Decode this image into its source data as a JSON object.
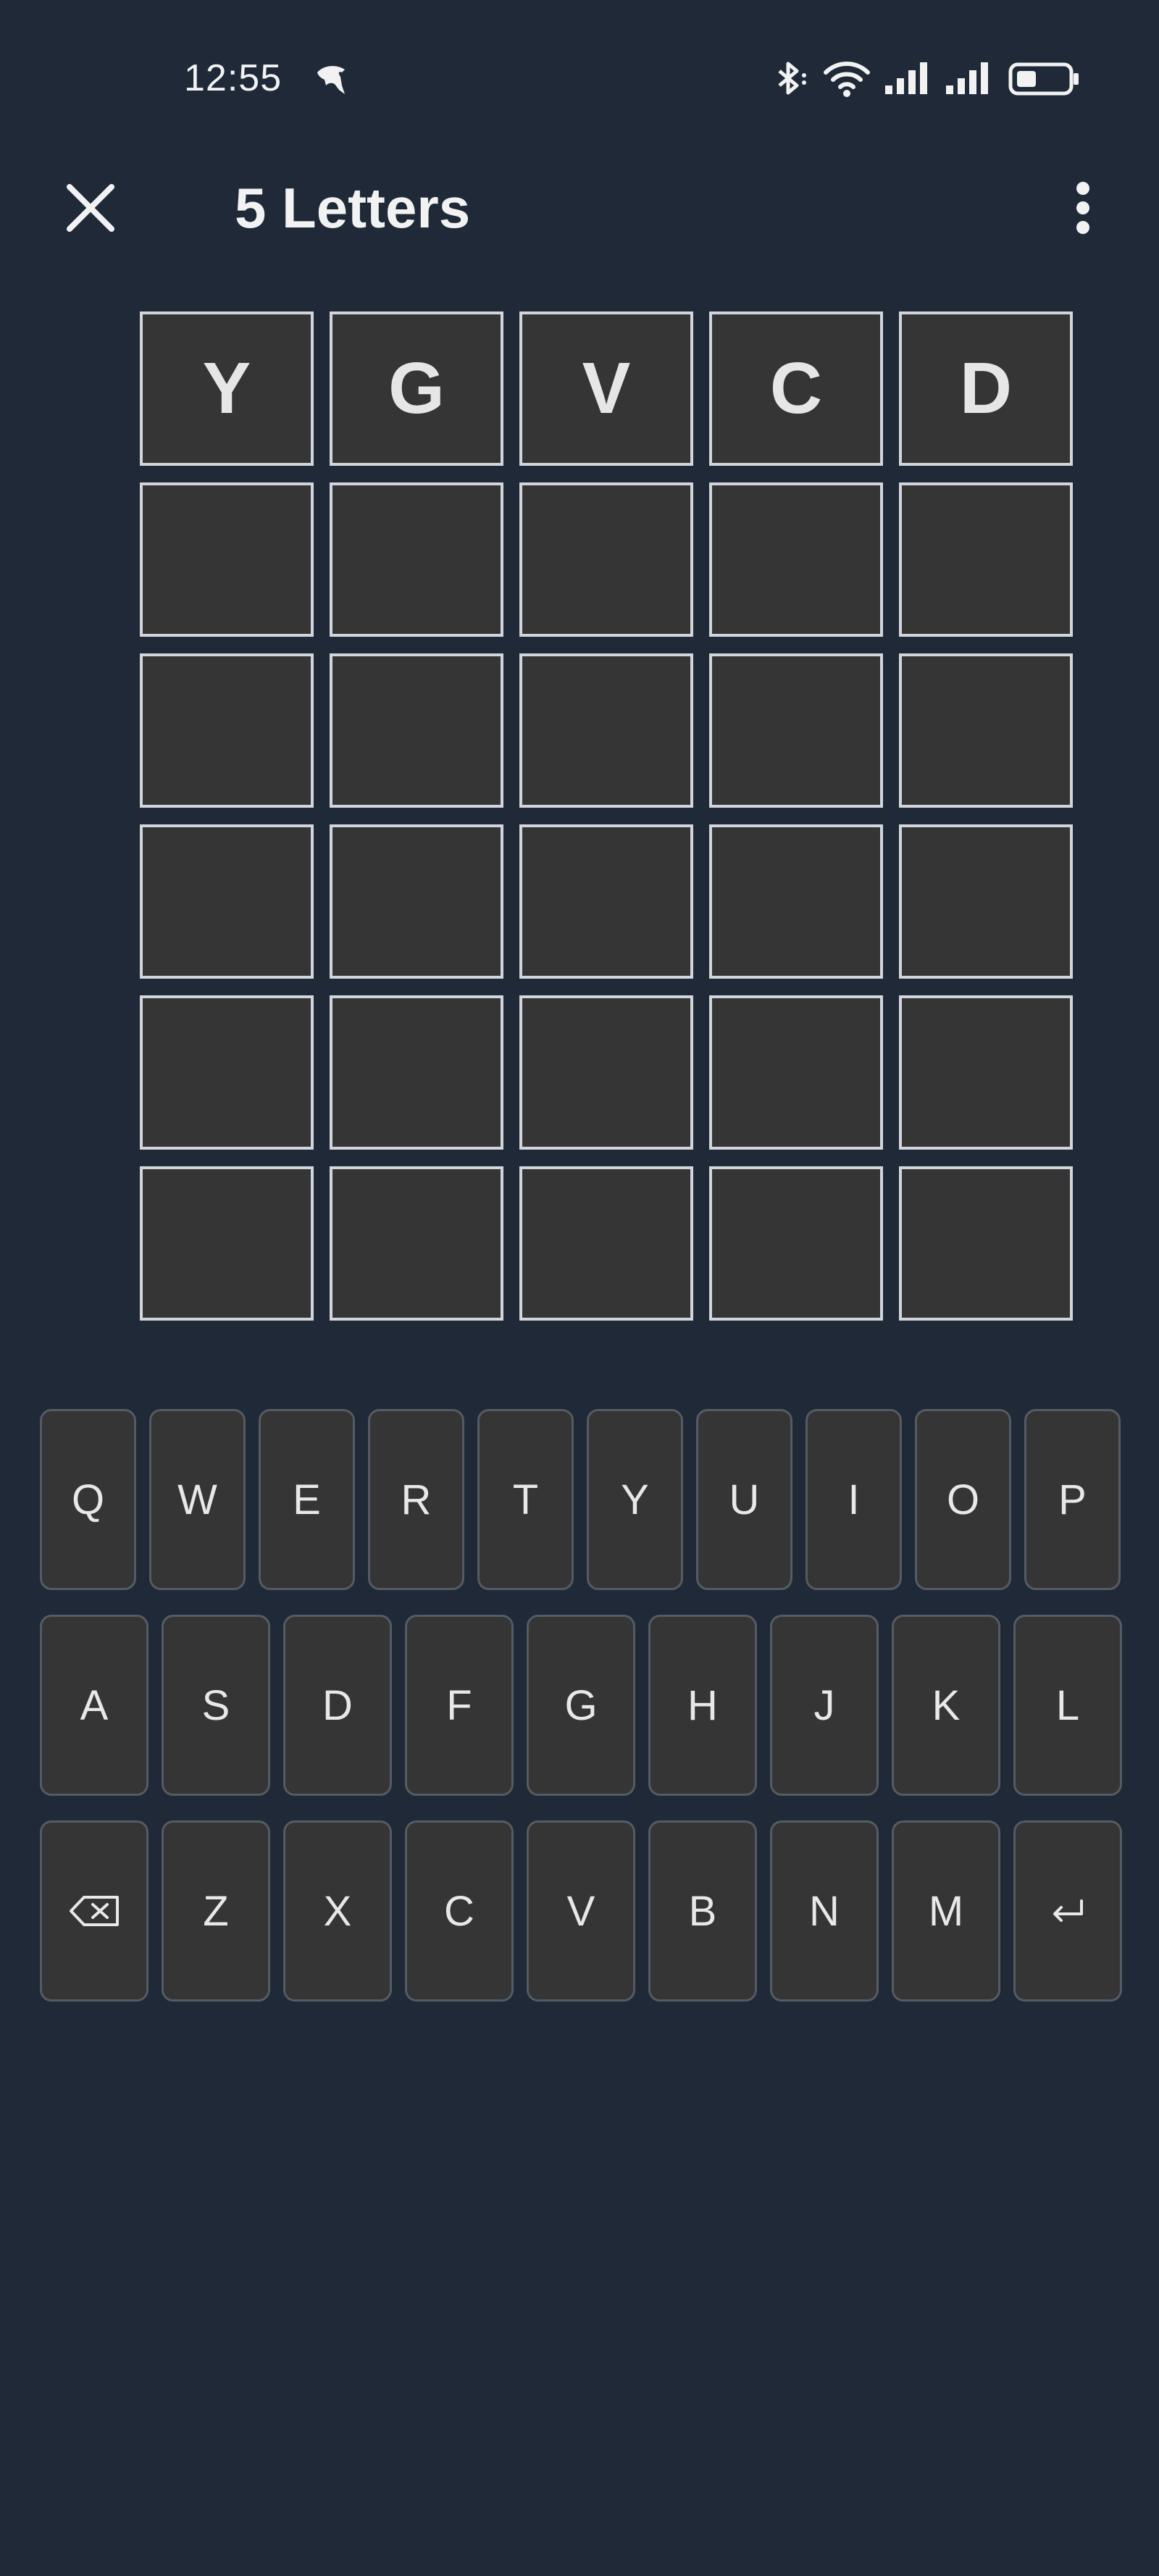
{
  "status_bar": {
    "time": "12:55",
    "icons": [
      "dolphin-icon",
      "bluetooth-icon",
      "wifi-icon",
      "signal-1-icon",
      "signal-2-icon",
      "battery-icon"
    ]
  },
  "header": {
    "title": "5 Letters",
    "close_icon": "close-icon",
    "menu_icon": "more-vert-icon"
  },
  "board": {
    "rows": [
      [
        "Y",
        "G",
        "V",
        "C",
        "D"
      ],
      [
        "",
        "",
        "",
        "",
        ""
      ],
      [
        "",
        "",
        "",
        "",
        ""
      ],
      [
        "",
        "",
        "",
        "",
        ""
      ],
      [
        "",
        "",
        "",
        "",
        ""
      ],
      [
        "",
        "",
        "",
        "",
        ""
      ]
    ]
  },
  "keyboard": {
    "row1": [
      "Q",
      "W",
      "E",
      "R",
      "T",
      "Y",
      "U",
      "I",
      "O",
      "P"
    ],
    "row2": [
      "A",
      "S",
      "D",
      "F",
      "G",
      "H",
      "J",
      "K",
      "L"
    ],
    "row3": [
      "Z",
      "X",
      "C",
      "V",
      "B",
      "N",
      "M"
    ],
    "backspace_icon": "backspace-icon",
    "enter_icon": "enter-icon"
  },
  "colors": {
    "background": "#1f2937",
    "tile": "#353535",
    "tile_border": "#d2d6da",
    "key": "#353535",
    "key_border": "#555b62",
    "text": "#eaeaea"
  }
}
